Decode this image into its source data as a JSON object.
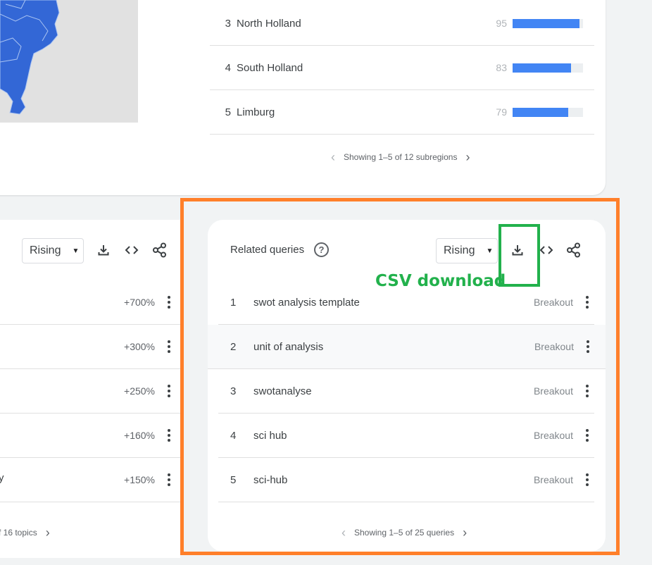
{
  "colors": {
    "map_fill": "#3367d6",
    "bar": "#4285f4",
    "annotation_orange": "#ff7f2a",
    "annotation_green": "#22b14c"
  },
  "subregions": {
    "rows": [
      {
        "rank": "3",
        "name": "North Holland",
        "value": "95",
        "fill_percent": 95
      },
      {
        "rank": "4",
        "name": "South Holland",
        "value": "83",
        "fill_percent": 83
      },
      {
        "rank": "5",
        "name": "Limburg",
        "value": "79",
        "fill_percent": 79
      }
    ],
    "pager_text": "Showing 1–5 of 12 subregions"
  },
  "related_topics": {
    "dropdown_value": "Rising",
    "values": [
      "+700%",
      "+300%",
      "+250%",
      "+160%",
      "+150%"
    ],
    "partial_label": "y",
    "pager_text": "f 16 topics"
  },
  "related_queries": {
    "title": "Related queries",
    "dropdown_value": "Rising",
    "rows": [
      {
        "rank": "1",
        "label": "swot analysis template",
        "value": "Breakout"
      },
      {
        "rank": "2",
        "label": "unit of analysis",
        "value": "Breakout"
      },
      {
        "rank": "3",
        "label": "swotanalyse",
        "value": "Breakout"
      },
      {
        "rank": "4",
        "label": "sci hub",
        "value": "Breakout"
      },
      {
        "rank": "5",
        "label": "sci-hub",
        "value": "Breakout"
      }
    ],
    "pager_text": "Showing 1–5 of 25 queries"
  },
  "annotation": {
    "csv_label": "CSV download"
  },
  "icons": [
    "download-icon",
    "embed-code-icon",
    "share-icon",
    "help-icon",
    "more-vert-icon",
    "chevron-left-icon",
    "chevron-right-icon",
    "dropdown-caret-icon"
  ]
}
